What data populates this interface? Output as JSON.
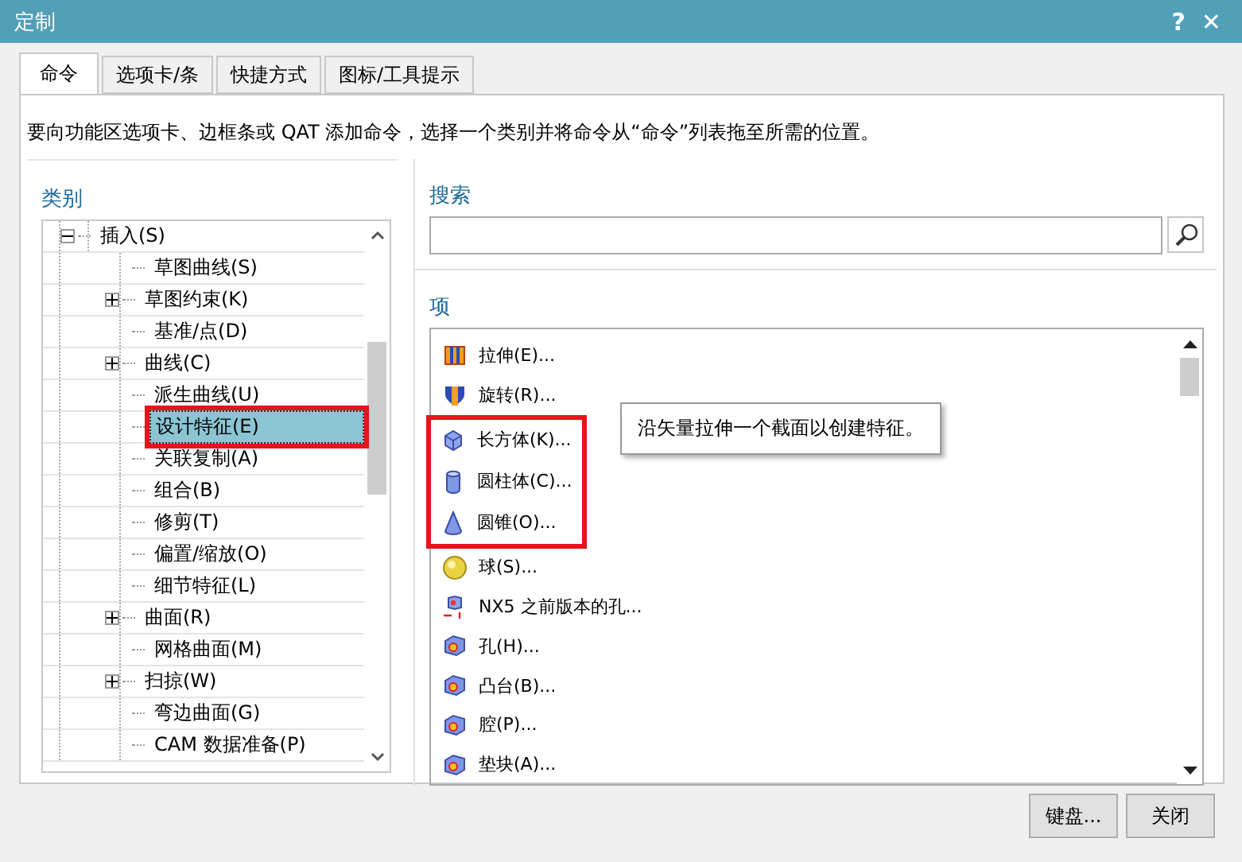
{
  "window": {
    "title": "定制",
    "help": "?",
    "close": "✕"
  },
  "tabs": [
    {
      "label": "命令",
      "selected": true
    },
    {
      "label": "选项卡/条",
      "selected": false
    },
    {
      "label": "快捷方式",
      "selected": false
    },
    {
      "label": "图标/工具提示",
      "selected": false
    }
  ],
  "description": "要向功能区选项卡、边框条或 QAT 添加命令，选择一个类别并将命令从“命令”列表拖至所需的位置。",
  "category": {
    "label": "类别",
    "tree": [
      {
        "label": "插入(S)",
        "expanded": true,
        "selected": false,
        "marked": false,
        "children": [
          {
            "label": "草图曲线(S)",
            "expandable": false,
            "selected": false,
            "marked": false
          },
          {
            "label": "草图约束(K)",
            "expandable": true,
            "selected": false,
            "marked": false
          },
          {
            "label": "基准/点(D)",
            "expandable": false,
            "selected": false,
            "marked": false
          },
          {
            "label": "曲线(C)",
            "expandable": true,
            "selected": false,
            "marked": false
          },
          {
            "label": "派生曲线(U)",
            "expandable": false,
            "selected": false,
            "marked": false
          },
          {
            "label": "设计特征(E)",
            "expandable": false,
            "selected": true,
            "marked": true
          },
          {
            "label": "关联复制(A)",
            "expandable": false,
            "selected": false,
            "marked": false
          },
          {
            "label": "组合(B)",
            "expandable": false,
            "selected": false,
            "marked": false
          },
          {
            "label": "修剪(T)",
            "expandable": false,
            "selected": false,
            "marked": false
          },
          {
            "label": "偏置/缩放(O)",
            "expandable": false,
            "selected": false,
            "marked": false
          },
          {
            "label": "细节特征(L)",
            "expandable": false,
            "selected": false,
            "marked": false
          },
          {
            "label": "曲面(R)",
            "expandable": true,
            "selected": false,
            "marked": false
          },
          {
            "label": "网格曲面(M)",
            "expandable": false,
            "selected": false,
            "marked": false
          },
          {
            "label": "扫掠(W)",
            "expandable": true,
            "selected": false,
            "marked": false
          },
          {
            "label": "弯边曲面(G)",
            "expandable": false,
            "selected": false,
            "marked": false
          },
          {
            "label": "CAM 数据准备(P)",
            "expandable": false,
            "selected": false,
            "marked": false
          }
        ]
      }
    ]
  },
  "search": {
    "label": "搜索"
  },
  "items": {
    "label": "项",
    "rows": [
      {
        "label": "拉伸(E)...",
        "kind": "extrude",
        "marked": false
      },
      {
        "label": "旋转(R)...",
        "kind": "revolve",
        "marked": false
      },
      {
        "label": "长方体(K)...",
        "kind": "block",
        "marked": true
      },
      {
        "label": "圆柱体(C)...",
        "kind": "cylinder",
        "marked": true
      },
      {
        "label": "圆锥(O)...",
        "kind": "cone",
        "marked": true
      },
      {
        "label": "球(S)...",
        "kind": "sphere",
        "marked": false
      },
      {
        "label": "NX5 之前版本的孔...",
        "kind": "legacy",
        "marked": false
      },
      {
        "label": "孔(H)...",
        "kind": "feature",
        "marked": false
      },
      {
        "label": "凸台(B)...",
        "kind": "feature",
        "marked": false
      },
      {
        "label": "腔(P)...",
        "kind": "feature",
        "marked": false
      },
      {
        "label": "垫块(A)...",
        "kind": "feature",
        "marked": false
      }
    ]
  },
  "tooltip": "沿矢量拉伸一个截面以创建特征。",
  "buttons": [
    {
      "label": "键盘..."
    },
    {
      "label": "关闭"
    }
  ]
}
